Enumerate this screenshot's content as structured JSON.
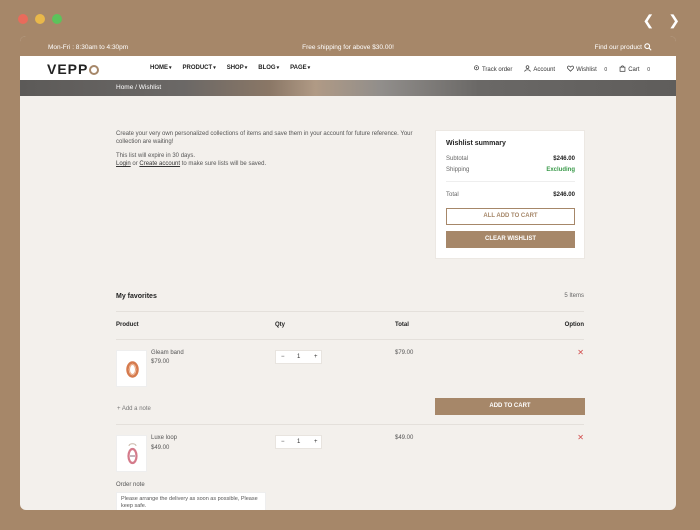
{
  "window": {
    "dots": [
      "#e96b5b",
      "#e9b84a",
      "#5cc35b"
    ]
  },
  "topbar": {
    "hours": "Mon-Fri : 8:30am to 4:30pm",
    "promo": "Free shipping for above $30.00!",
    "search_placeholder": "Find our product"
  },
  "header": {
    "logo": "VEPP",
    "menu": [
      "HOME",
      "PRODUCT",
      "SHOP",
      "BLOG",
      "PAGE"
    ],
    "track_order": "Track order",
    "account": "Account",
    "wishlist": "Wishlist",
    "wishlist_count": "0",
    "cart": "Cart",
    "cart_count": "0"
  },
  "breadcrumb": "Home / Wishlist",
  "intro": {
    "line1": "Create your very own personalized collections of items and save them in your account for future reference. Your collection are waiting!",
    "line2": "This list will expire in 30 days.",
    "login": "Login",
    "or": "or",
    "create_account": "Create account",
    "line3_suffix": "to make sure lists will be saved."
  },
  "summary": {
    "title": "Wishlist summary",
    "subtotal_label": "Subtotal",
    "subtotal_value": "$246.00",
    "shipping_label": "Shipping",
    "shipping_value": "Excluding",
    "total_label": "Total",
    "total_value": "$246.00",
    "add_all_label": "ALL ADD TO CART",
    "clear_label": "CLEAR WISHLIST"
  },
  "favorites": {
    "title": "My favorites",
    "count": "5 Items",
    "columns": [
      "Product",
      "Qty",
      "Total",
      "Option"
    ],
    "items": [
      {
        "name": "Gleam band",
        "price": "$79.00",
        "qty": "1",
        "total": "$79.00"
      },
      {
        "name": "Luxe loop",
        "price": "$49.00",
        "qty": "1",
        "total": "$49.00"
      }
    ],
    "add_note": "Add a note",
    "add_to_cart": "ADD TO CART"
  },
  "order_note": {
    "label": "Order note",
    "value": "Please arrange the delivery as soon as possible, Please keep safe."
  },
  "colors": {
    "accent": "#a68769",
    "remove": "#d14a4a",
    "success": "#3a9a4a"
  }
}
